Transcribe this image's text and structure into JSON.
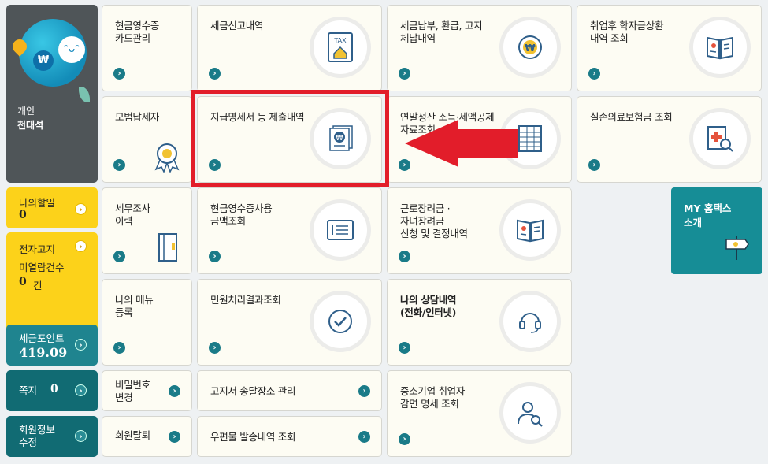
{
  "profile": {
    "type_label": "개인",
    "name": "천대석"
  },
  "left": {
    "discount": {
      "label": "나의할일",
      "count": "0"
    },
    "enotice": {
      "label1": "전자고지",
      "label2": "미열람건수",
      "count": "0",
      "unit": "건"
    },
    "points": {
      "label": "세금포인트",
      "value": "419.09"
    },
    "messages": {
      "label": "쪽지",
      "count": "0"
    },
    "member": {
      "label": "회원정보\n수정"
    }
  },
  "tiles": {
    "cash_receipt_card": "현금영수증\n카드관리",
    "tax_report": "세금신고내역",
    "tax_payment": "세금납부, 환급, 고지\n체납내역",
    "student_loan": "취업후 학자금상환\n내역 조회",
    "model_taxpayer": "모범납세자",
    "payment_statement": "지급명세서 등 제출내역",
    "year_end": "연말정산 소득·세액공제\n자료조회",
    "medical_insurance": "실손의료보험금 조회",
    "tax_audit": "세무조사\n이력",
    "cash_receipt_usage": "현금영수증사용\n금액조회",
    "earned_income": "근로장려금 ·\n자녀장려금\n신청 및 결정내역",
    "my_menu": "나의 메뉴\n등록",
    "civil_result": "민원처리결과조회",
    "consultation": "나의 상담내역\n(전화/인터넷)",
    "password_change": "비밀번호\n변경",
    "notice_address": "고지서 송달장소 관리",
    "sme_employment": "중소기업 취업자\n감면 명세 조회",
    "withdraw": "회원탈퇴",
    "mail_history": "우편물 발송내역 조회"
  },
  "my_hometax": "MY 홈택스\n소개",
  "icons": {
    "tax_icon_text": "TAX",
    "won": "₩"
  },
  "colors": {
    "teal": "#1a7b88",
    "yellow": "#fcd21a",
    "highlight": "#e21d2a"
  }
}
